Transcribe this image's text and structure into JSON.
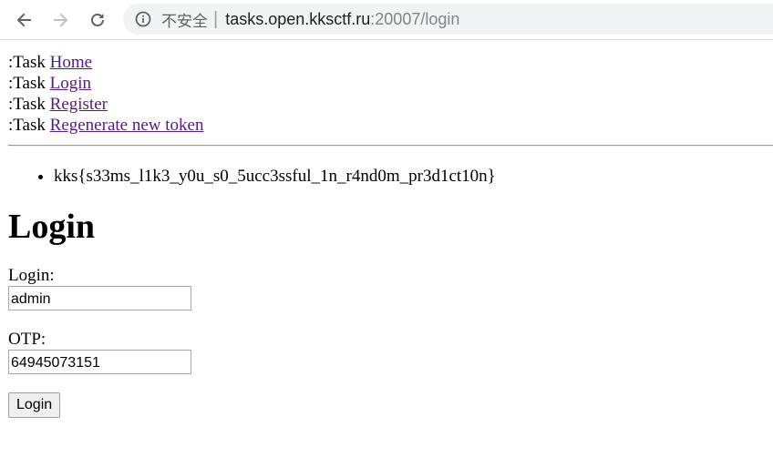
{
  "browser": {
    "security_label": "不安全",
    "separator": "|",
    "url_host": "tasks.open.kksctf.ru",
    "url_path": ":20007/login"
  },
  "nav": [
    {
      "prefix": ":Task ",
      "link": "Home"
    },
    {
      "prefix": ":Task ",
      "link": "Login"
    },
    {
      "prefix": ":Task ",
      "link": "Register"
    },
    {
      "prefix": ":Task ",
      "link": "Regenerate new token"
    }
  ],
  "messages": [
    "kks{s33ms_l1k3_y0u_s0_5ucc3ssful_1n_r4nd0m_pr3d1ct10n}"
  ],
  "form": {
    "heading": "Login",
    "login_label": "Login:",
    "login_value": "admin",
    "otp_label": "OTP:",
    "otp_value": "64945073151",
    "submit_label": "Login"
  },
  "colors": {
    "link": "#551a8b",
    "omnibox_bg": "#f1f3f4"
  }
}
